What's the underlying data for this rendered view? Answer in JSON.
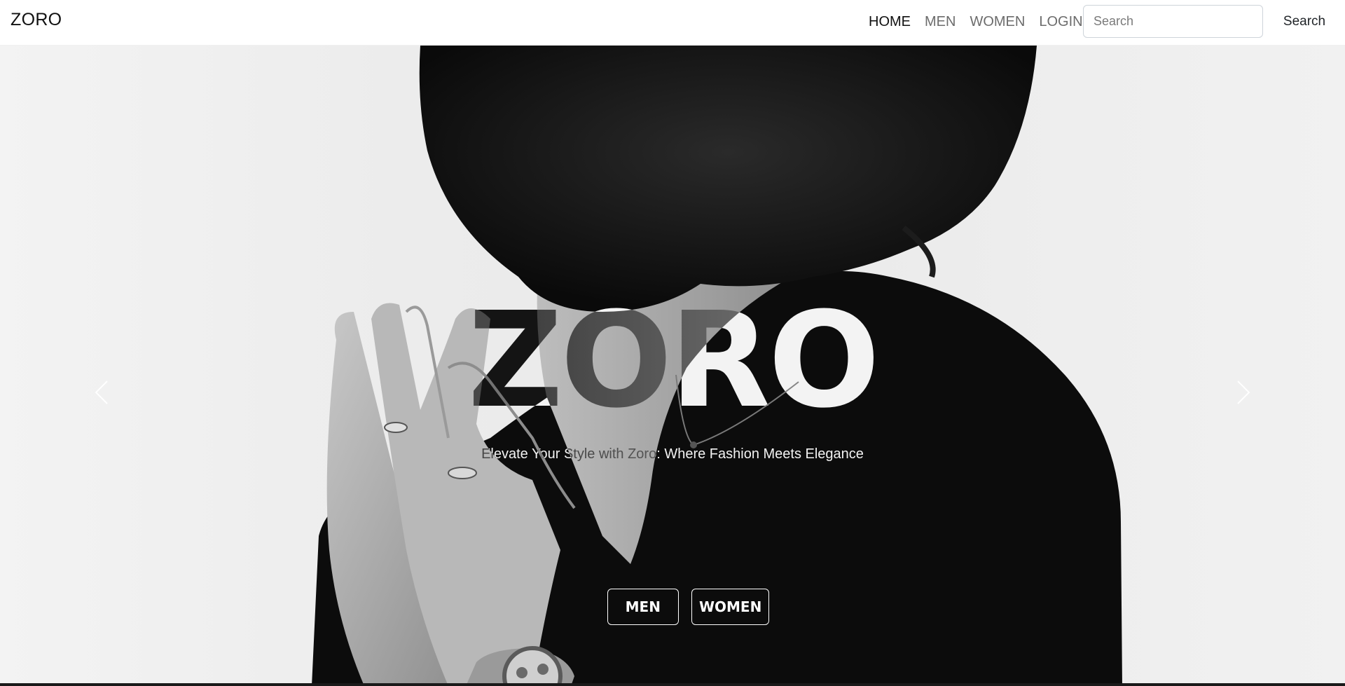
{
  "navbar": {
    "brand": "ZORO",
    "links": [
      {
        "label": "HOME",
        "active": true
      },
      {
        "label": "MEN",
        "active": false
      },
      {
        "label": "WOMEN",
        "active": false
      },
      {
        "label": "LOGIN",
        "active": false
      }
    ],
    "search": {
      "placeholder": "Search",
      "value": "",
      "button_label": "Search"
    }
  },
  "hero": {
    "title": "ZORO",
    "subtitle": "Elevate Your Style with Zoro: Where Fashion Meets Elegance",
    "buttons": {
      "men": "MEN",
      "women": "WOMEN"
    },
    "controls": {
      "prev_icon": "chevron-left-icon",
      "next_icon": "chevron-right-icon"
    }
  },
  "colors": {
    "nav_text": "#6c6c6c",
    "nav_active": "#111111",
    "hero_bg": "#ececec",
    "hero_dark": "#0c0c0c"
  }
}
